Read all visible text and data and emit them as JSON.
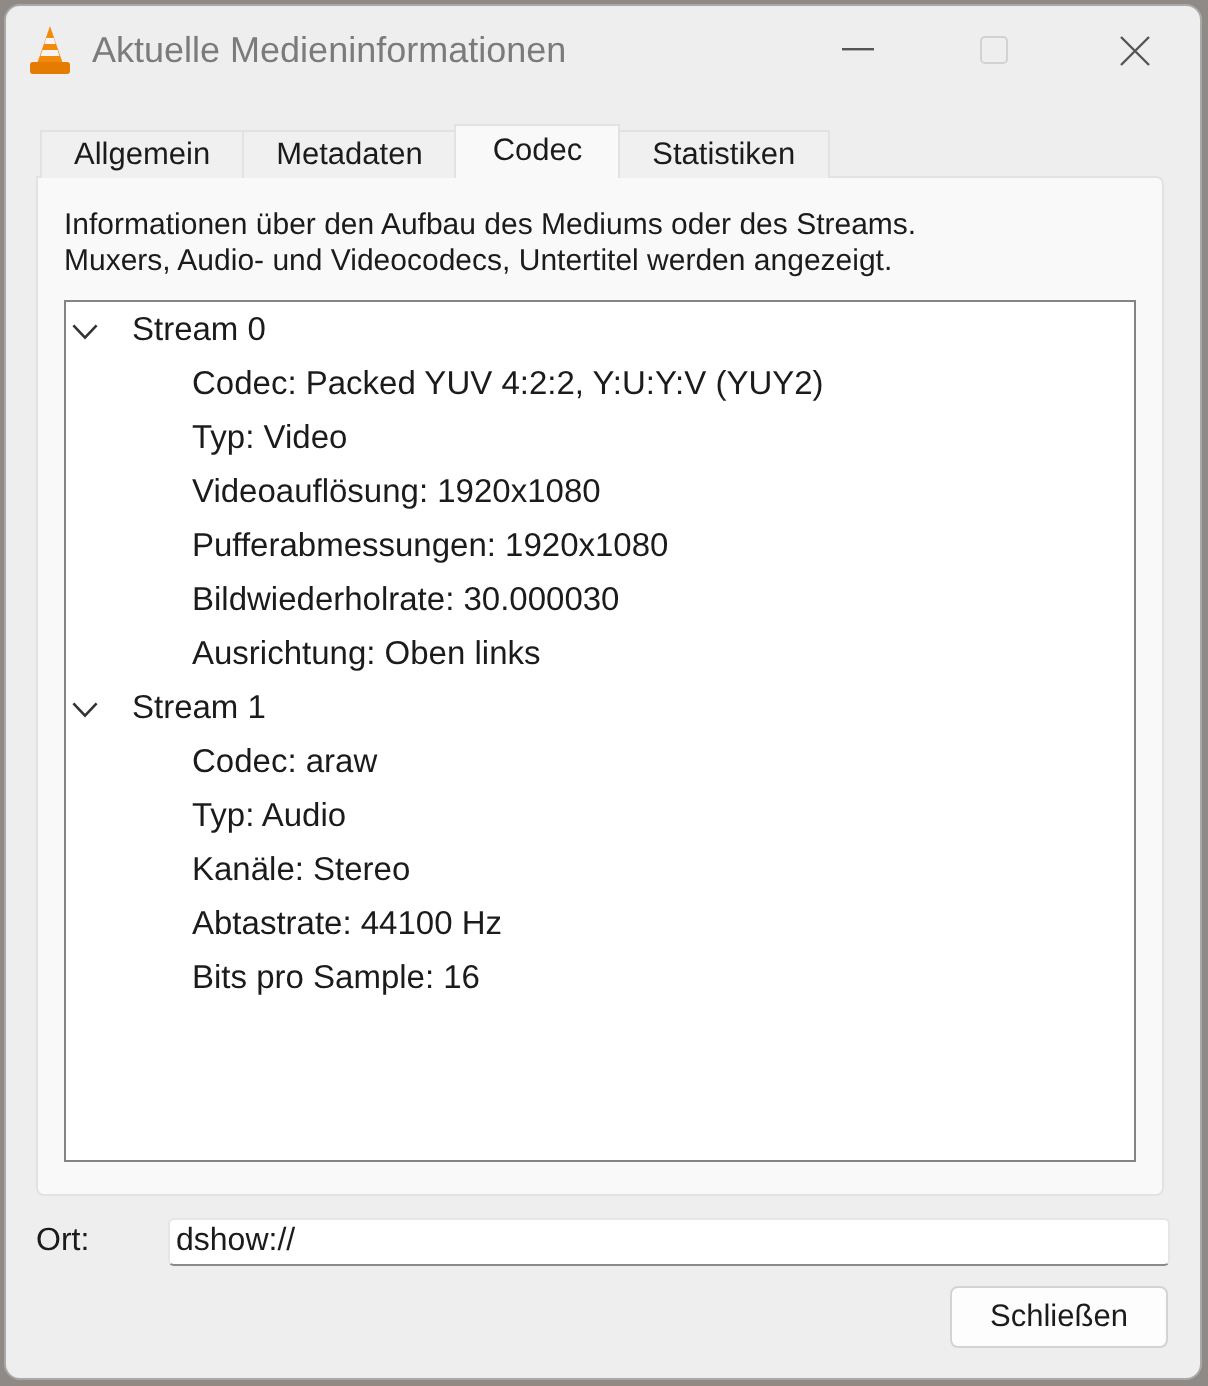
{
  "window": {
    "title": "Aktuelle Medieninformationen",
    "maximize_disabled": true
  },
  "tabs": [
    {
      "label": "Allgemein",
      "selected": false
    },
    {
      "label": "Metadaten",
      "selected": false
    },
    {
      "label": "Codec",
      "selected": true
    },
    {
      "label": "Statistiken",
      "selected": false
    }
  ],
  "codec_panel": {
    "description": "Informationen über den Aufbau des Mediums oder des Streams.\nMuxers, Audio- und Videocodecs, Untertitel werden angezeigt.",
    "stream_tree": [
      {
        "label": "Stream 0",
        "expanded": true,
        "children": [
          {
            "label": "Codec: Packed YUV 4:2:2, Y:U:Y:V (YUY2)"
          },
          {
            "label": "Typ: Video"
          },
          {
            "label": "Videoauflösung: 1920x1080"
          },
          {
            "label": "Pufferabmessungen: 1920x1080"
          },
          {
            "label": "Bildwiederholrate: 30.000030"
          },
          {
            "label": "Ausrichtung: Oben links"
          }
        ]
      },
      {
        "label": "Stream 1",
        "expanded": true,
        "children": [
          {
            "label": "Codec: araw"
          },
          {
            "label": "Typ: Audio"
          },
          {
            "label": "Kanäle: Stereo"
          },
          {
            "label": "Abtastrate: 44100 Hz"
          },
          {
            "label": "Bits pro Sample: 16"
          }
        ]
      }
    ]
  },
  "location": {
    "label": "Ort:",
    "value": "dshow://"
  },
  "close_button": {
    "label": "Schließen"
  }
}
